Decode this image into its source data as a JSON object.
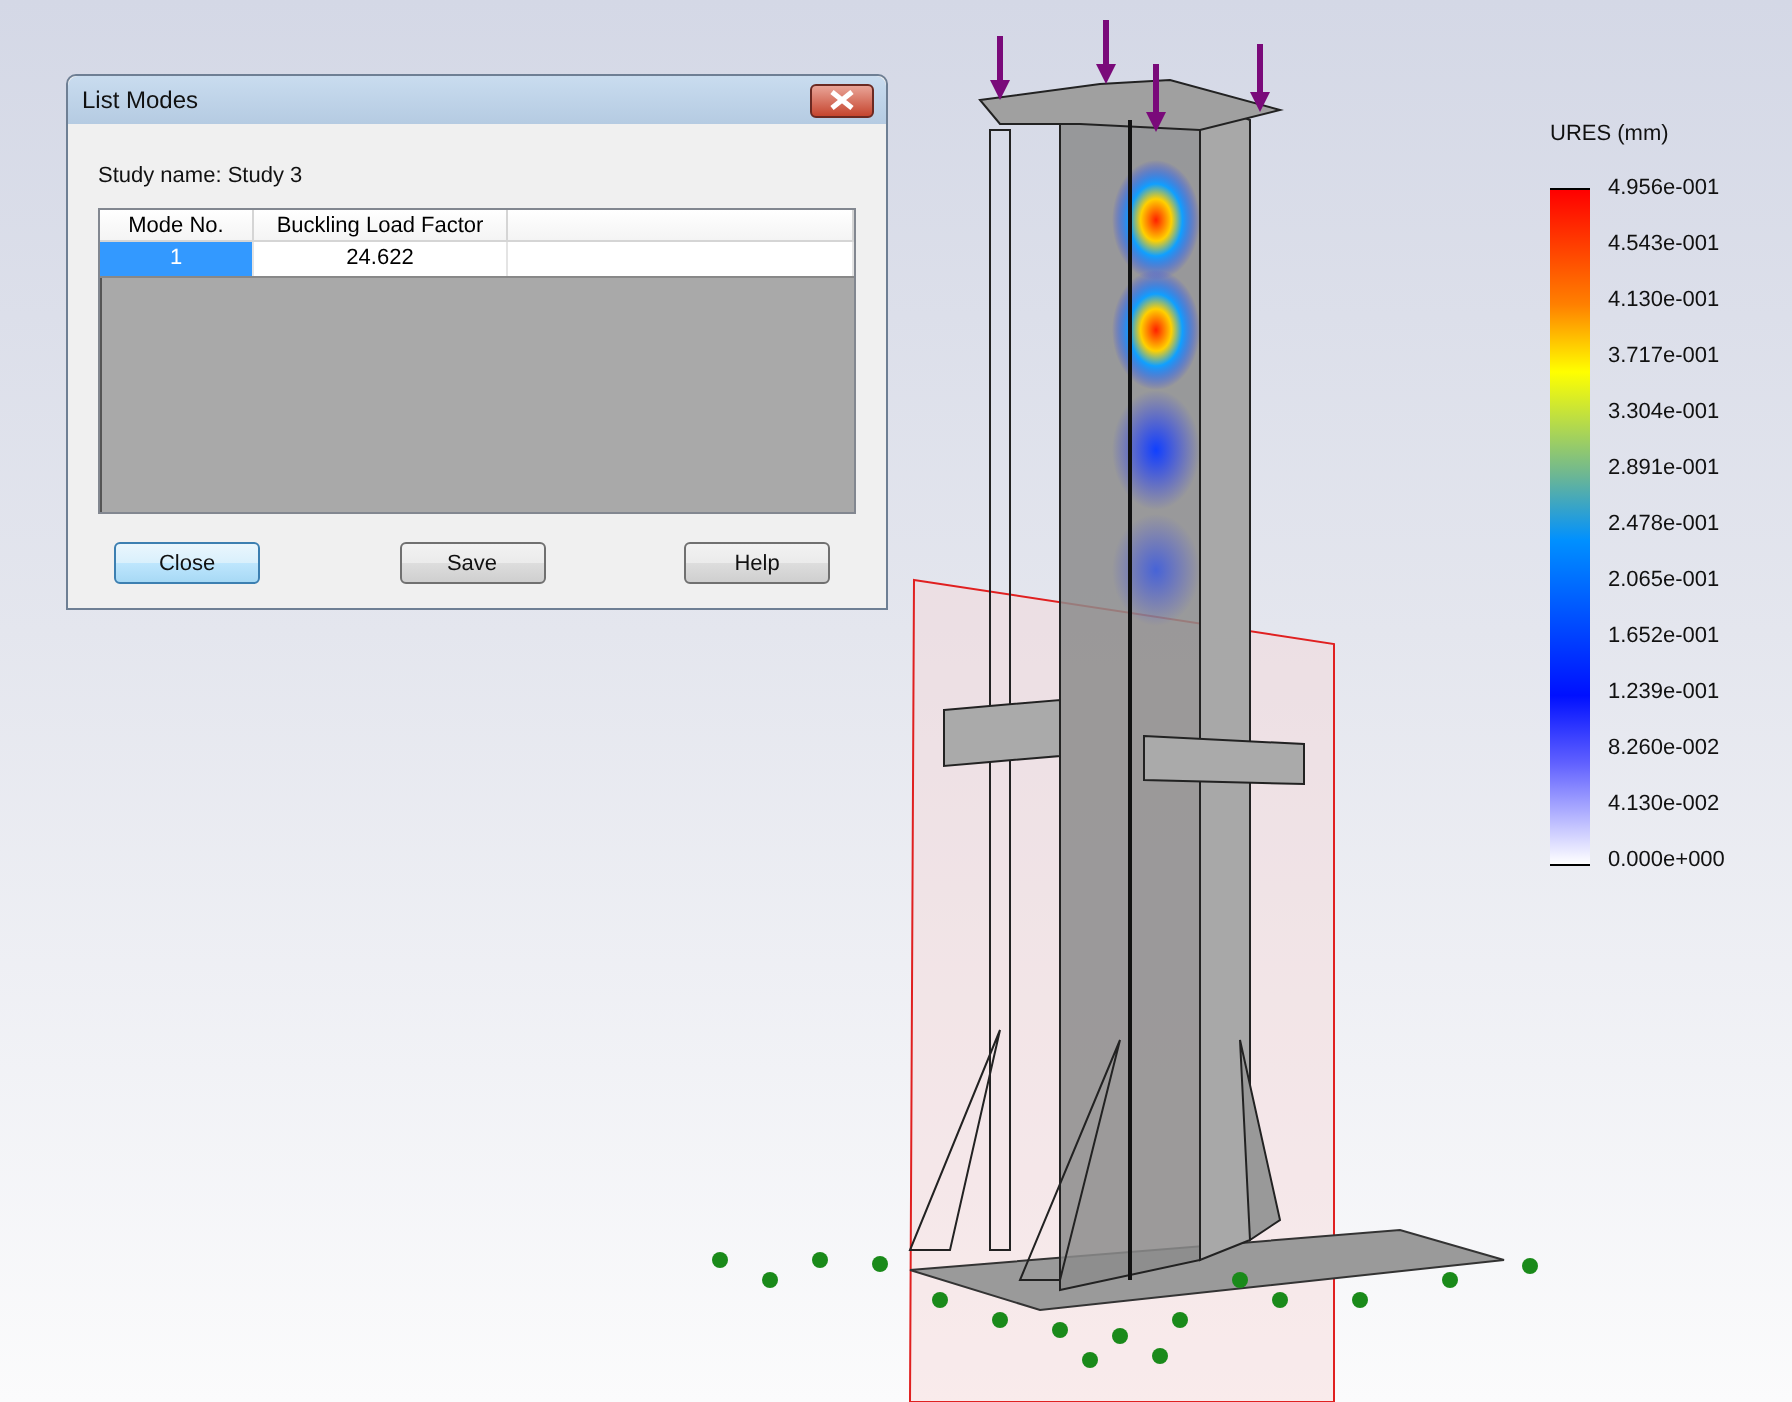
{
  "dialog": {
    "title": "List Modes",
    "study_label": "Study name: Study 3",
    "table": {
      "columns": [
        "Mode No.",
        "Buckling Load Factor"
      ],
      "rows": [
        {
          "cells": [
            "1",
            "24.622"
          ],
          "selected": true
        }
      ]
    },
    "buttons": [
      {
        "label": "Close",
        "default": true
      },
      {
        "label": "Save",
        "default": false
      },
      {
        "label": "Help",
        "default": false
      }
    ]
  },
  "legend": {
    "title": "URES (mm)",
    "labels": [
      "4.956e-001",
      "4.543e-001",
      "4.130e-001",
      "3.717e-001",
      "3.304e-001",
      "2.891e-001",
      "2.478e-001",
      "2.065e-001",
      "1.652e-001",
      "1.239e-001",
      "8.260e-002",
      "4.130e-002",
      "0.000e+000"
    ]
  }
}
